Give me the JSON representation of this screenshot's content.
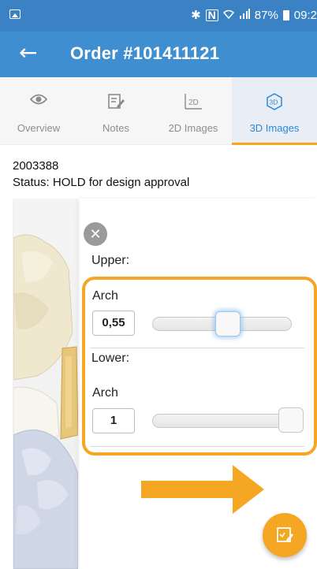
{
  "status_bar": {
    "icons": [
      "gallery-icon",
      "bluetooth-icon",
      "nfc-icon",
      "wifi-icon",
      "signal-icon",
      "battery-icon"
    ],
    "battery": "87%",
    "time": "09:2"
  },
  "app_bar": {
    "back_icon": "arrow-left-icon",
    "title": "Order #101411121",
    "color": "#3f8fd0"
  },
  "tabs": [
    {
      "label": "Overview",
      "icon": "eye-icon",
      "active": false
    },
    {
      "label": "Notes",
      "icon": "note-edit-icon",
      "active": false
    },
    {
      "label": "2D Images",
      "icon": "2d-icon",
      "active": false
    },
    {
      "label": "3D Images",
      "icon": "3d-icon",
      "active": true
    }
  ],
  "order": {
    "id": "2003388",
    "status": "Status: HOLD for design approval"
  },
  "panel": {
    "close_icon": "close-circle-icon",
    "upper_label": "Upper:",
    "upper_arch_label": "Arch",
    "upper_value": "0,55",
    "upper_slider_fraction": 0.55,
    "lower_label": "Lower:",
    "lower_arch_label": "Arch",
    "lower_value": "1",
    "lower_slider_fraction": 1.0
  },
  "fab": {
    "icon": "checklist-edit-icon",
    "color": "#f5a623"
  },
  "colors": {
    "accent": "#f5a623",
    "primary": "#3f8fd0",
    "active_tab": "#2a8ad6"
  }
}
